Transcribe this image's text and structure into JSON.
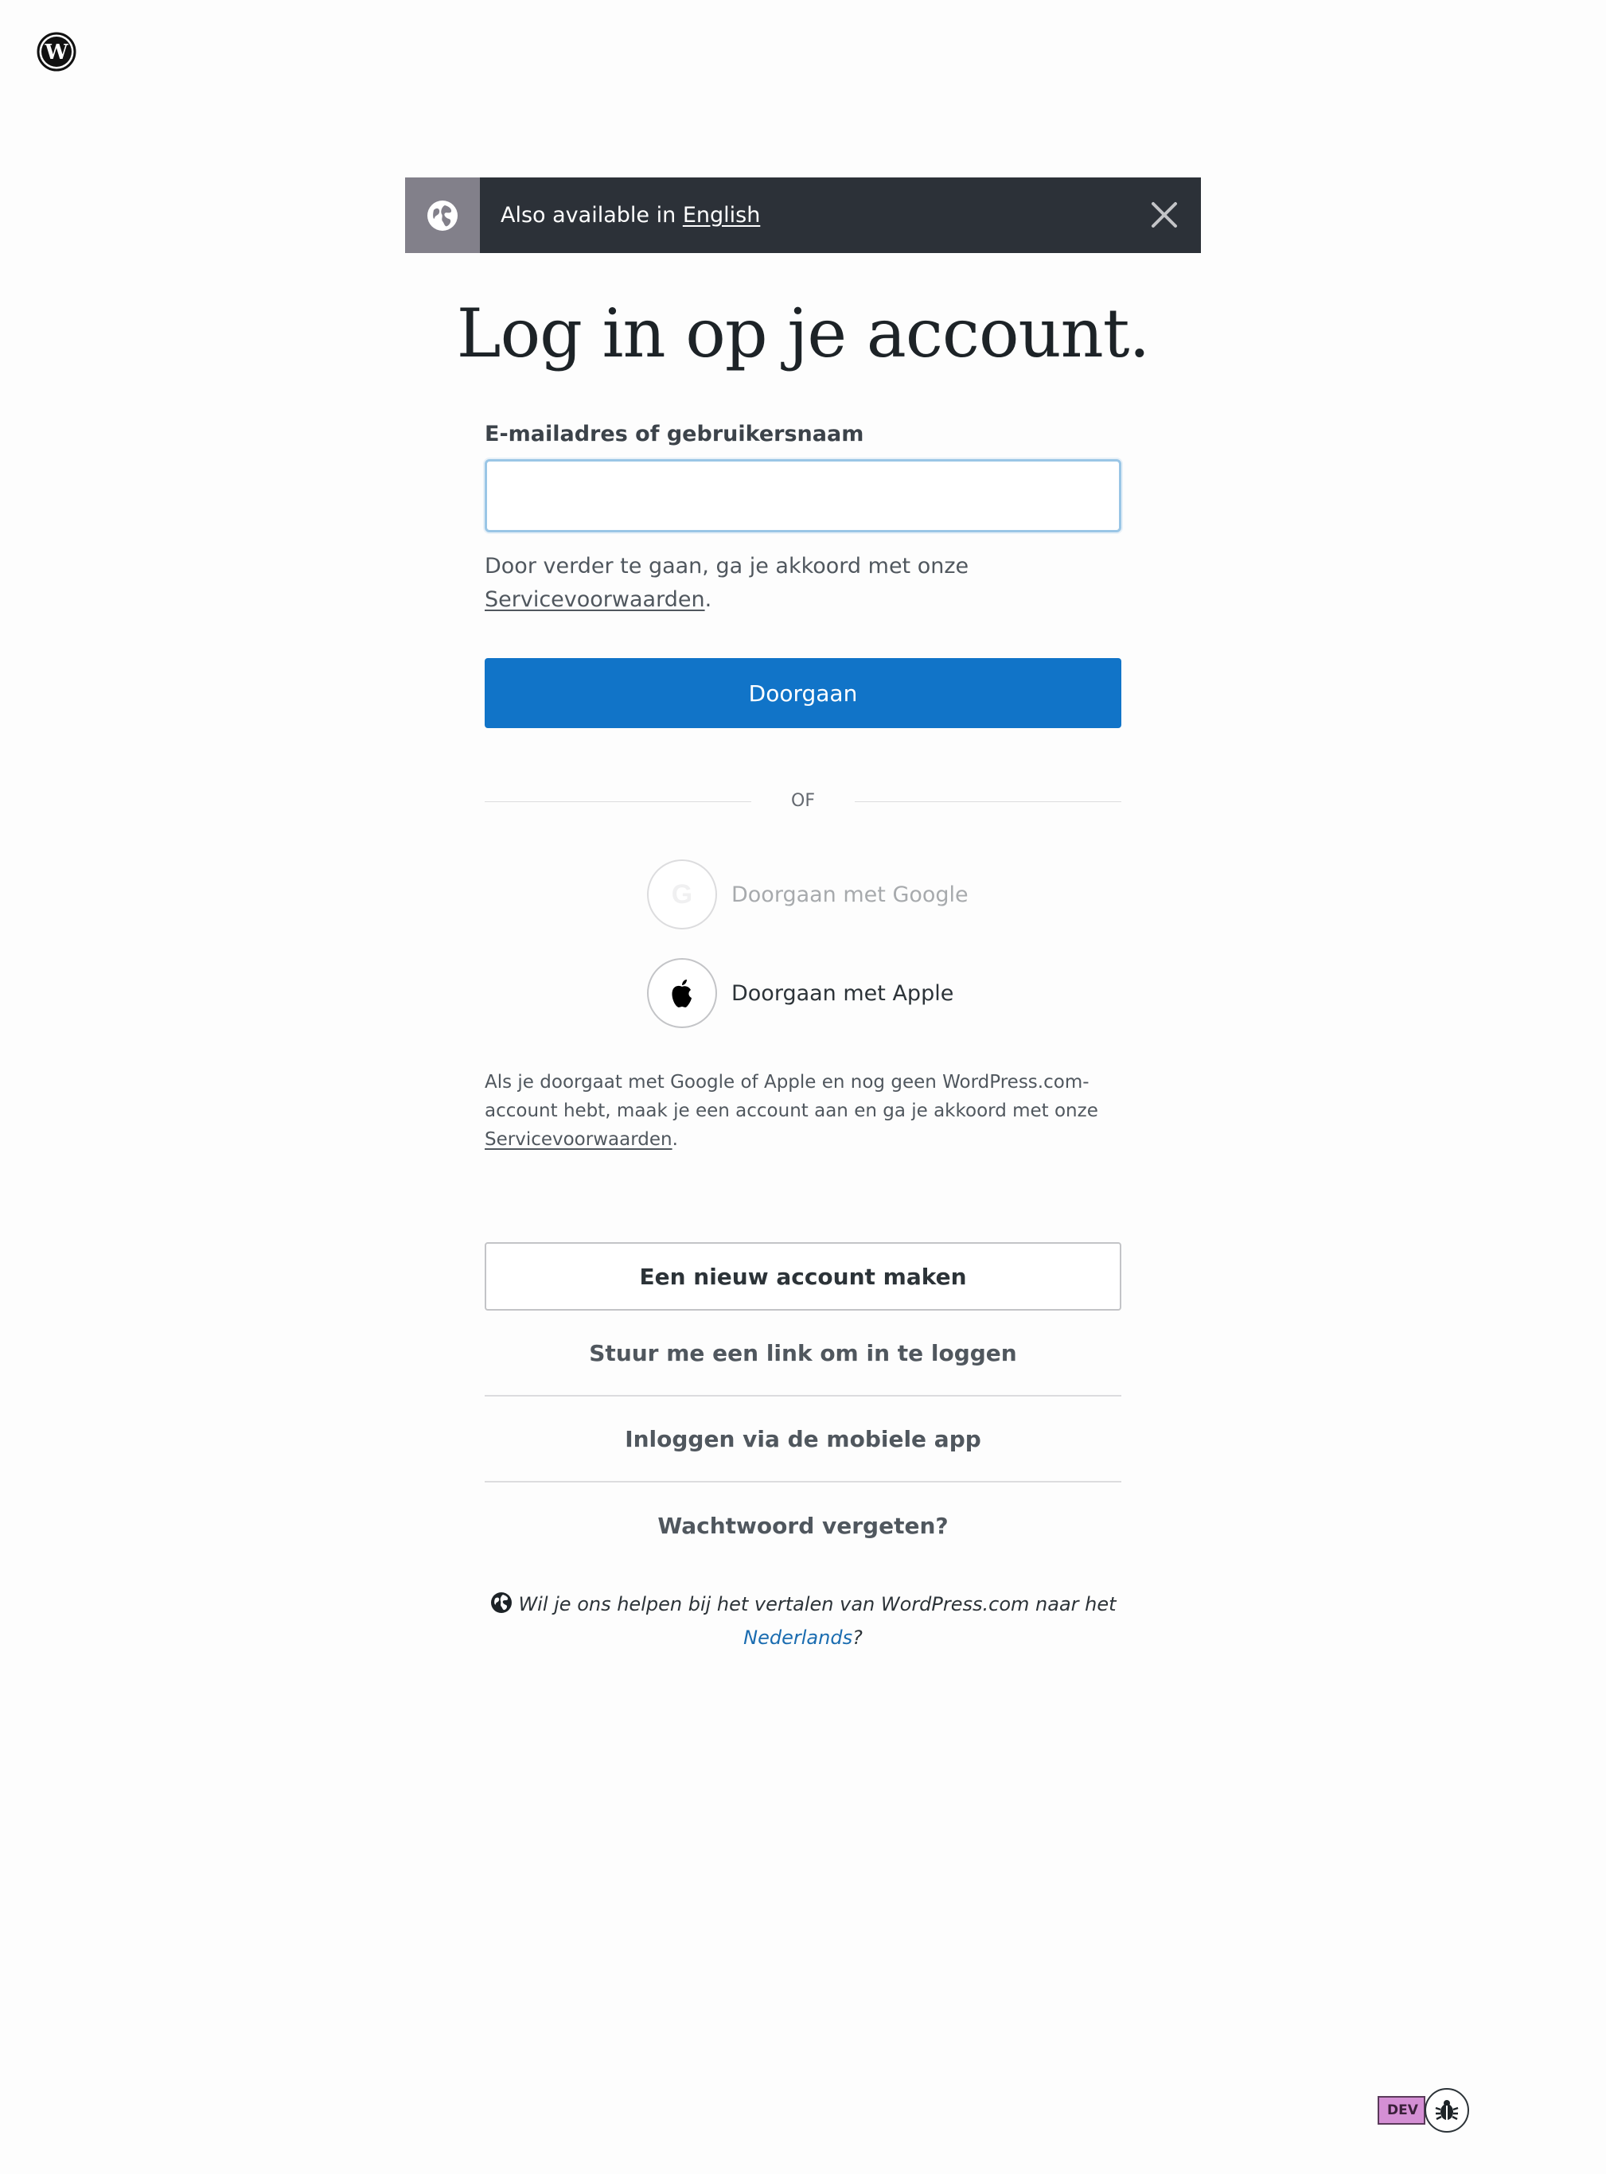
{
  "notice": {
    "prefix": "Also available in",
    "language_link": "English",
    "icon": "globe-icon",
    "close_icon": "close-icon"
  },
  "heading": "Log in op je account.",
  "form": {
    "label": "E-mailadres of gebruikersnaam",
    "input_value": "",
    "tos_prefix": "Door verder te gaan, ga je akkoord met onze",
    "tos_link": "Servicevoorwaarden",
    "tos_suffix": ".",
    "continue_label": "Doorgaan"
  },
  "divider_label": "OF",
  "social": {
    "google_label": "Doorgaan met Google",
    "google_icon": "google-icon",
    "apple_label": "Doorgaan met Apple",
    "apple_icon": "apple-icon",
    "note_prefix": "Als je doorgaat met Google of Apple en nog geen WordPress.com-account hebt, maak je een account aan en ga je akkoord met onze",
    "note_link": "Servicevoorwaarden",
    "note_suffix": "."
  },
  "actions": {
    "new_account": "Een nieuw account maken",
    "magic_link": "Stuur me een link om in te loggen",
    "mobile_app": "Inloggen via de mobiele app",
    "forgot_password": "Wachtwoord vergeten?"
  },
  "translate": {
    "prefix": "Wil je ons helpen bij het vertalen van WordPress.com naar het",
    "link": "Nederlands",
    "suffix": "?"
  },
  "dev": {
    "badge": "DEV"
  },
  "colors": {
    "primary": "#1174c8",
    "notice_bg": "#2c3138",
    "notice_icon_bg": "#82808a",
    "link": "#1a6cb0"
  }
}
